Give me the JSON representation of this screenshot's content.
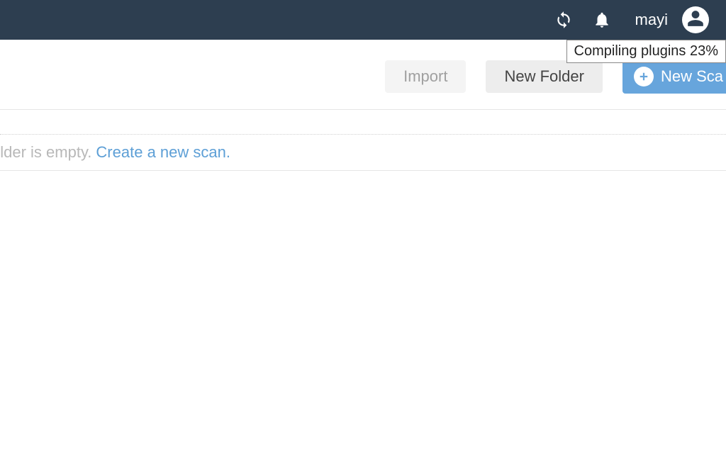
{
  "header": {
    "username": "mayi",
    "tooltip": "Compiling plugins 23%"
  },
  "toolbar": {
    "import_label": "Import",
    "new_folder_label": "New Folder",
    "new_scan_label": "New Sca"
  },
  "content": {
    "empty_text": "older is empty.",
    "create_link": "Create a new scan."
  }
}
